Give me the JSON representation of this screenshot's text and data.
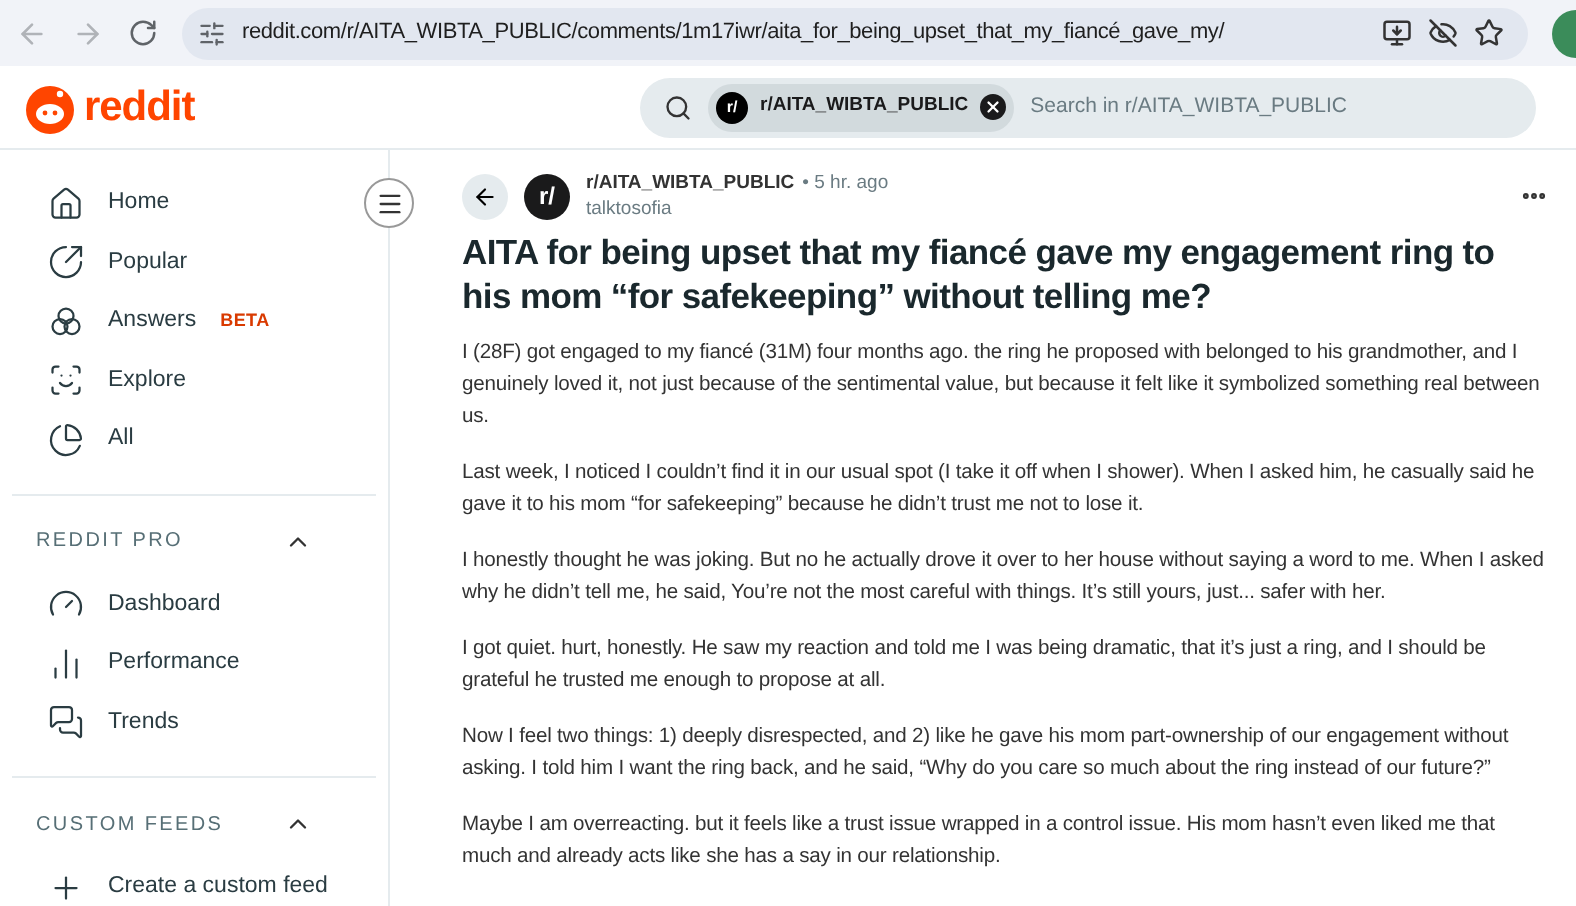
{
  "browser": {
    "url": "reddit.com/r/AITA_WIBTA_PUBLIC/comments/1m17iwr/aita_for_being_upset_that_my_fiancé_gave_my/"
  },
  "header": {
    "logo": "reddit",
    "search": {
      "chip_icon": "r/",
      "chip": "r/AITA_WIBTA_PUBLIC",
      "placeholder": "Search in r/AITA_WIBTA_PUBLIC"
    }
  },
  "sidebar": {
    "items": [
      {
        "kind": "home",
        "label": "Home"
      },
      {
        "kind": "popular",
        "label": "Popular"
      },
      {
        "kind": "answers",
        "label": "Answers",
        "badge": "BETA"
      },
      {
        "kind": "explore",
        "label": "Explore"
      },
      {
        "kind": "all",
        "label": "All"
      }
    ],
    "sections": [
      {
        "title": "REDDIT PRO",
        "expanded": true,
        "items": [
          {
            "kind": "dashboard",
            "label": "Dashboard"
          },
          {
            "kind": "performance",
            "label": "Performance"
          },
          {
            "kind": "trends",
            "label": "Trends"
          }
        ]
      },
      {
        "title": "CUSTOM FEEDS",
        "expanded": true,
        "items": [
          {
            "kind": "create",
            "label": "Create a custom feed"
          }
        ]
      }
    ]
  },
  "post": {
    "community_icon": "r/",
    "community": "r/AITA_WIBTA_PUBLIC",
    "time": "• 5 hr. ago",
    "author": "talktosofia",
    "title": "AITA for being upset that my fiancé gave my engagement ring to his mom “for safekeeping” without telling me?",
    "paragraphs": [
      "I (28F) got engaged to my fiancé (31M) four months ago. the ring he proposed with belonged to his grandmother, and I genuinely loved it, not just because of the sentimental value, but because it felt like it symbolized something real between us.",
      "Last week, I noticed I couldn’t find it in our usual spot (I take it off when I shower). When I asked him, he casually said he gave it to his mom “for safekeeping” because he didn’t trust me not to lose it.",
      "I honestly thought he was joking. But no he actually drove it over to her house without saying a word to me. When I asked why he didn’t tell me, he said, You’re not the most careful with things. It’s still yours, just... safer with her.",
      "I got quiet. hurt, honestly. He saw my reaction and told me I was being dramatic, that it’s just a ring, and I should be grateful he trusted me enough to propose at all.",
      "Now I feel two things: 1) deeply disrespected, and 2) like he gave his mom part-ownership of our engagement without asking. I told him I want the ring back, and he said, “Why do you care so much about the ring instead of our future?”",
      "Maybe I am overreacting. but it feels like a trust issue wrapped in a control issue. His mom hasn’t even liked me that much and already acts like she has a say in our relationship."
    ]
  }
}
